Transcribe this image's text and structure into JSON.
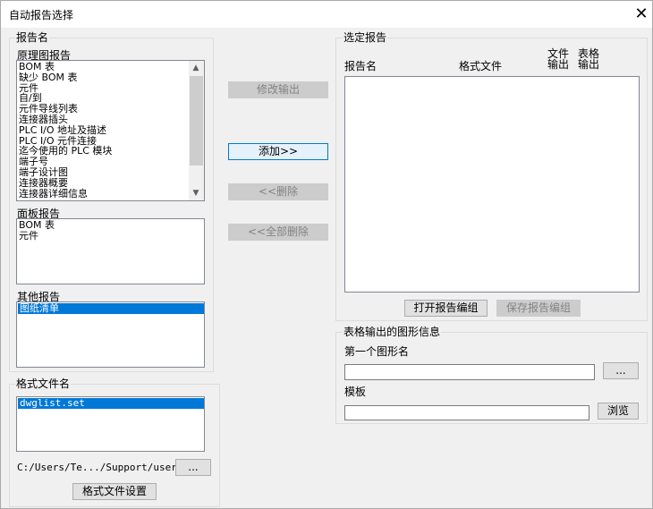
{
  "window": {
    "title": "自动报告选择",
    "close_glyph": "✕"
  },
  "report_names": {
    "group_label": "报告名",
    "schematic": {
      "label": "原理图报告",
      "items": [
        "BOM 表",
        "缺少 BOM 表",
        "元件",
        "自/到",
        "元件导线列表",
        "连接器插头",
        "PLC I/O 地址及描述",
        "PLC I/O 元件连接",
        "迄今使用的 PLC 模块",
        "端子号",
        "端子设计图",
        "连接器概要",
        "连接器详细信息"
      ]
    },
    "panel": {
      "label": "面板报告",
      "items": [
        "BOM 表",
        "元件"
      ]
    },
    "other": {
      "label": "其他报告",
      "selected_item": "图纸清单"
    }
  },
  "buttons": {
    "modify_output": "修改输出",
    "add": "添加>>",
    "remove": "<<删除",
    "remove_all": "<<全部删除",
    "open_report_group": "打开报告编组",
    "save_report_group": "保存报告编组",
    "format_settings": "格式文件设置",
    "browse_ellipsis": "...",
    "browse": "浏览"
  },
  "selected_reports": {
    "group_label": "选定报告",
    "columns": {
      "report_name": "报告名",
      "format_file": "格式文件",
      "file_output_line1": "文件",
      "file_output_line2": "输出",
      "table_output_line1": "表格",
      "table_output_line2": "输出"
    }
  },
  "table_output_info": {
    "group_label": "表格输出的图形信息",
    "first_graphic_label": "第一个图形名",
    "first_graphic_value": "",
    "template_label": "模板",
    "template_value": ""
  },
  "format_file": {
    "group_label": "格式文件名",
    "selected_file": "dwglist.set",
    "path": "C:/Users/Te.../Support/user/"
  }
}
